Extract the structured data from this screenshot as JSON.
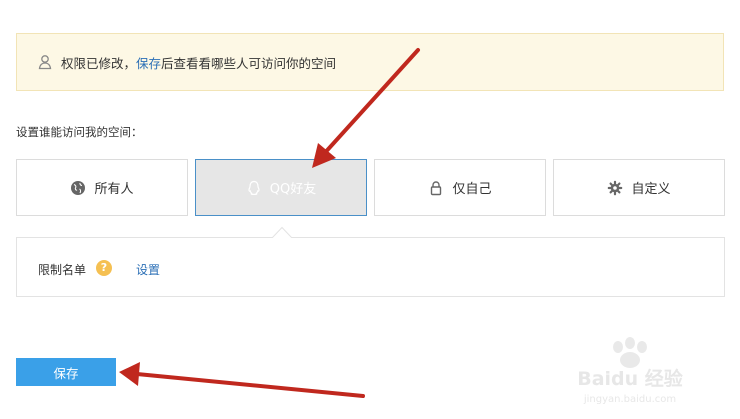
{
  "notice": {
    "text_before": "权限已修改，",
    "link": "保存",
    "text_after": "后查看看哪些人可访问你的空间"
  },
  "prompt": "设置谁能访问我的空间：",
  "options": [
    {
      "label": "所有人",
      "icon": "globe-icon",
      "selected": false
    },
    {
      "label": "QQ好友",
      "icon": "qq-icon",
      "selected": true
    },
    {
      "label": "仅自己",
      "icon": "lock-icon",
      "selected": false
    },
    {
      "label": "自定义",
      "icon": "gear-icon",
      "selected": false
    }
  ],
  "restrict": {
    "label": "限制名单",
    "help": "?",
    "link": "设置"
  },
  "save_button": "保存",
  "colors": {
    "accent": "#3aa0e8",
    "link": "#2b6fb6",
    "notice_bg": "#fdf8e5",
    "selected_border": "#4a90c8",
    "arrow": "#c0281e"
  },
  "watermark": {
    "brand": "Baidu 经验",
    "url": "jingyan.baidu.com"
  }
}
